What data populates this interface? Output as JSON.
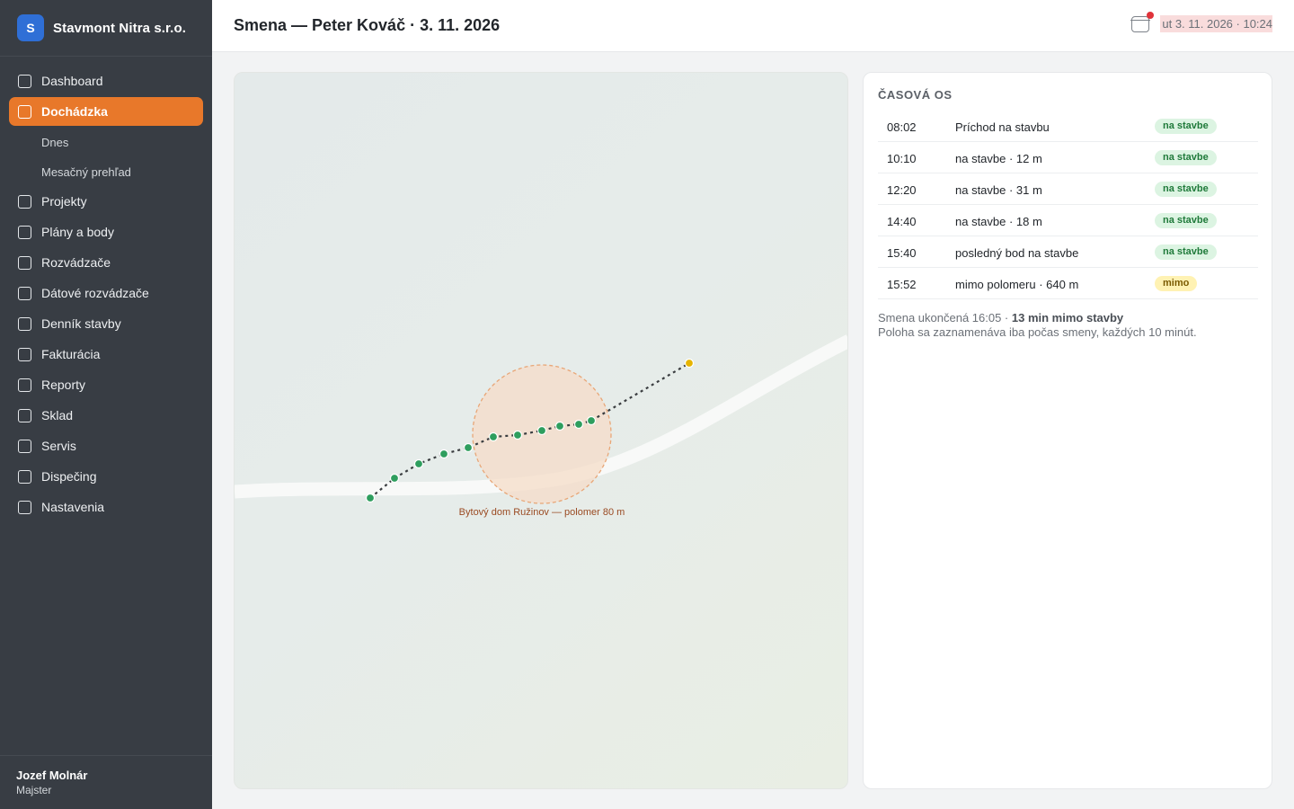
{
  "brand": {
    "logo_letter": "S",
    "name": "Stavmont Nitra s.r.o."
  },
  "sidebar": {
    "items": [
      {
        "label": "Dashboard"
      },
      {
        "label": "Dochádzka",
        "active": true
      },
      {
        "label": "Projekty"
      },
      {
        "label": "Plány a body"
      },
      {
        "label": "Rozvádzače"
      },
      {
        "label": "Dátové rozvádzače"
      },
      {
        "label": "Denník stavby"
      },
      {
        "label": "Fakturácia"
      },
      {
        "label": "Reporty"
      },
      {
        "label": "Sklad"
      },
      {
        "label": "Servis"
      },
      {
        "label": "Dispečing"
      },
      {
        "label": "Nastavenia"
      }
    ],
    "subitems": [
      {
        "label": "Dnes"
      },
      {
        "label": "Mesačný prehľad"
      }
    ]
  },
  "user": {
    "name": "Jozef Molnár",
    "role": "Majster"
  },
  "header": {
    "title": "Smena — Peter Kováč · 3. 11. 2026",
    "datetime": "ut 3. 11. 2026 · 10:24",
    "icon": "calendar-icon"
  },
  "map": {
    "geofence_label": "Bytový dom Ružinov — polomer 80 m",
    "colors": {
      "inside": "#2e9e5e",
      "outside": "#e6b400",
      "geofence": "#e8a677"
    }
  },
  "timeline": {
    "title": "ČASOVÁ OS",
    "rows": [
      {
        "time": "08:02",
        "desc": "Príchod na stavbu",
        "badge": "na stavbe",
        "status": "ok"
      },
      {
        "time": "10:10",
        "desc": "na stavbe · 12 m",
        "badge": "na stavbe",
        "status": "ok"
      },
      {
        "time": "12:20",
        "desc": "na stavbe · 31 m",
        "badge": "na stavbe",
        "status": "ok"
      },
      {
        "time": "14:40",
        "desc": "na stavbe · 18 m",
        "badge": "na stavbe",
        "status": "ok"
      },
      {
        "time": "15:40",
        "desc": "posledný bod na stavbe",
        "badge": "na stavbe",
        "status": "ok"
      },
      {
        "time": "15:52",
        "desc": "mimo polomeru · 640 m",
        "badge": "mimo",
        "status": "out"
      }
    ],
    "footer_prefix": "Smena ukončená 16:05 · ",
    "footer_bold": "13 min mimo stavby",
    "footer_line2": "Poloha sa zaznamenáva iba počas smeny, každých 10 minút."
  }
}
